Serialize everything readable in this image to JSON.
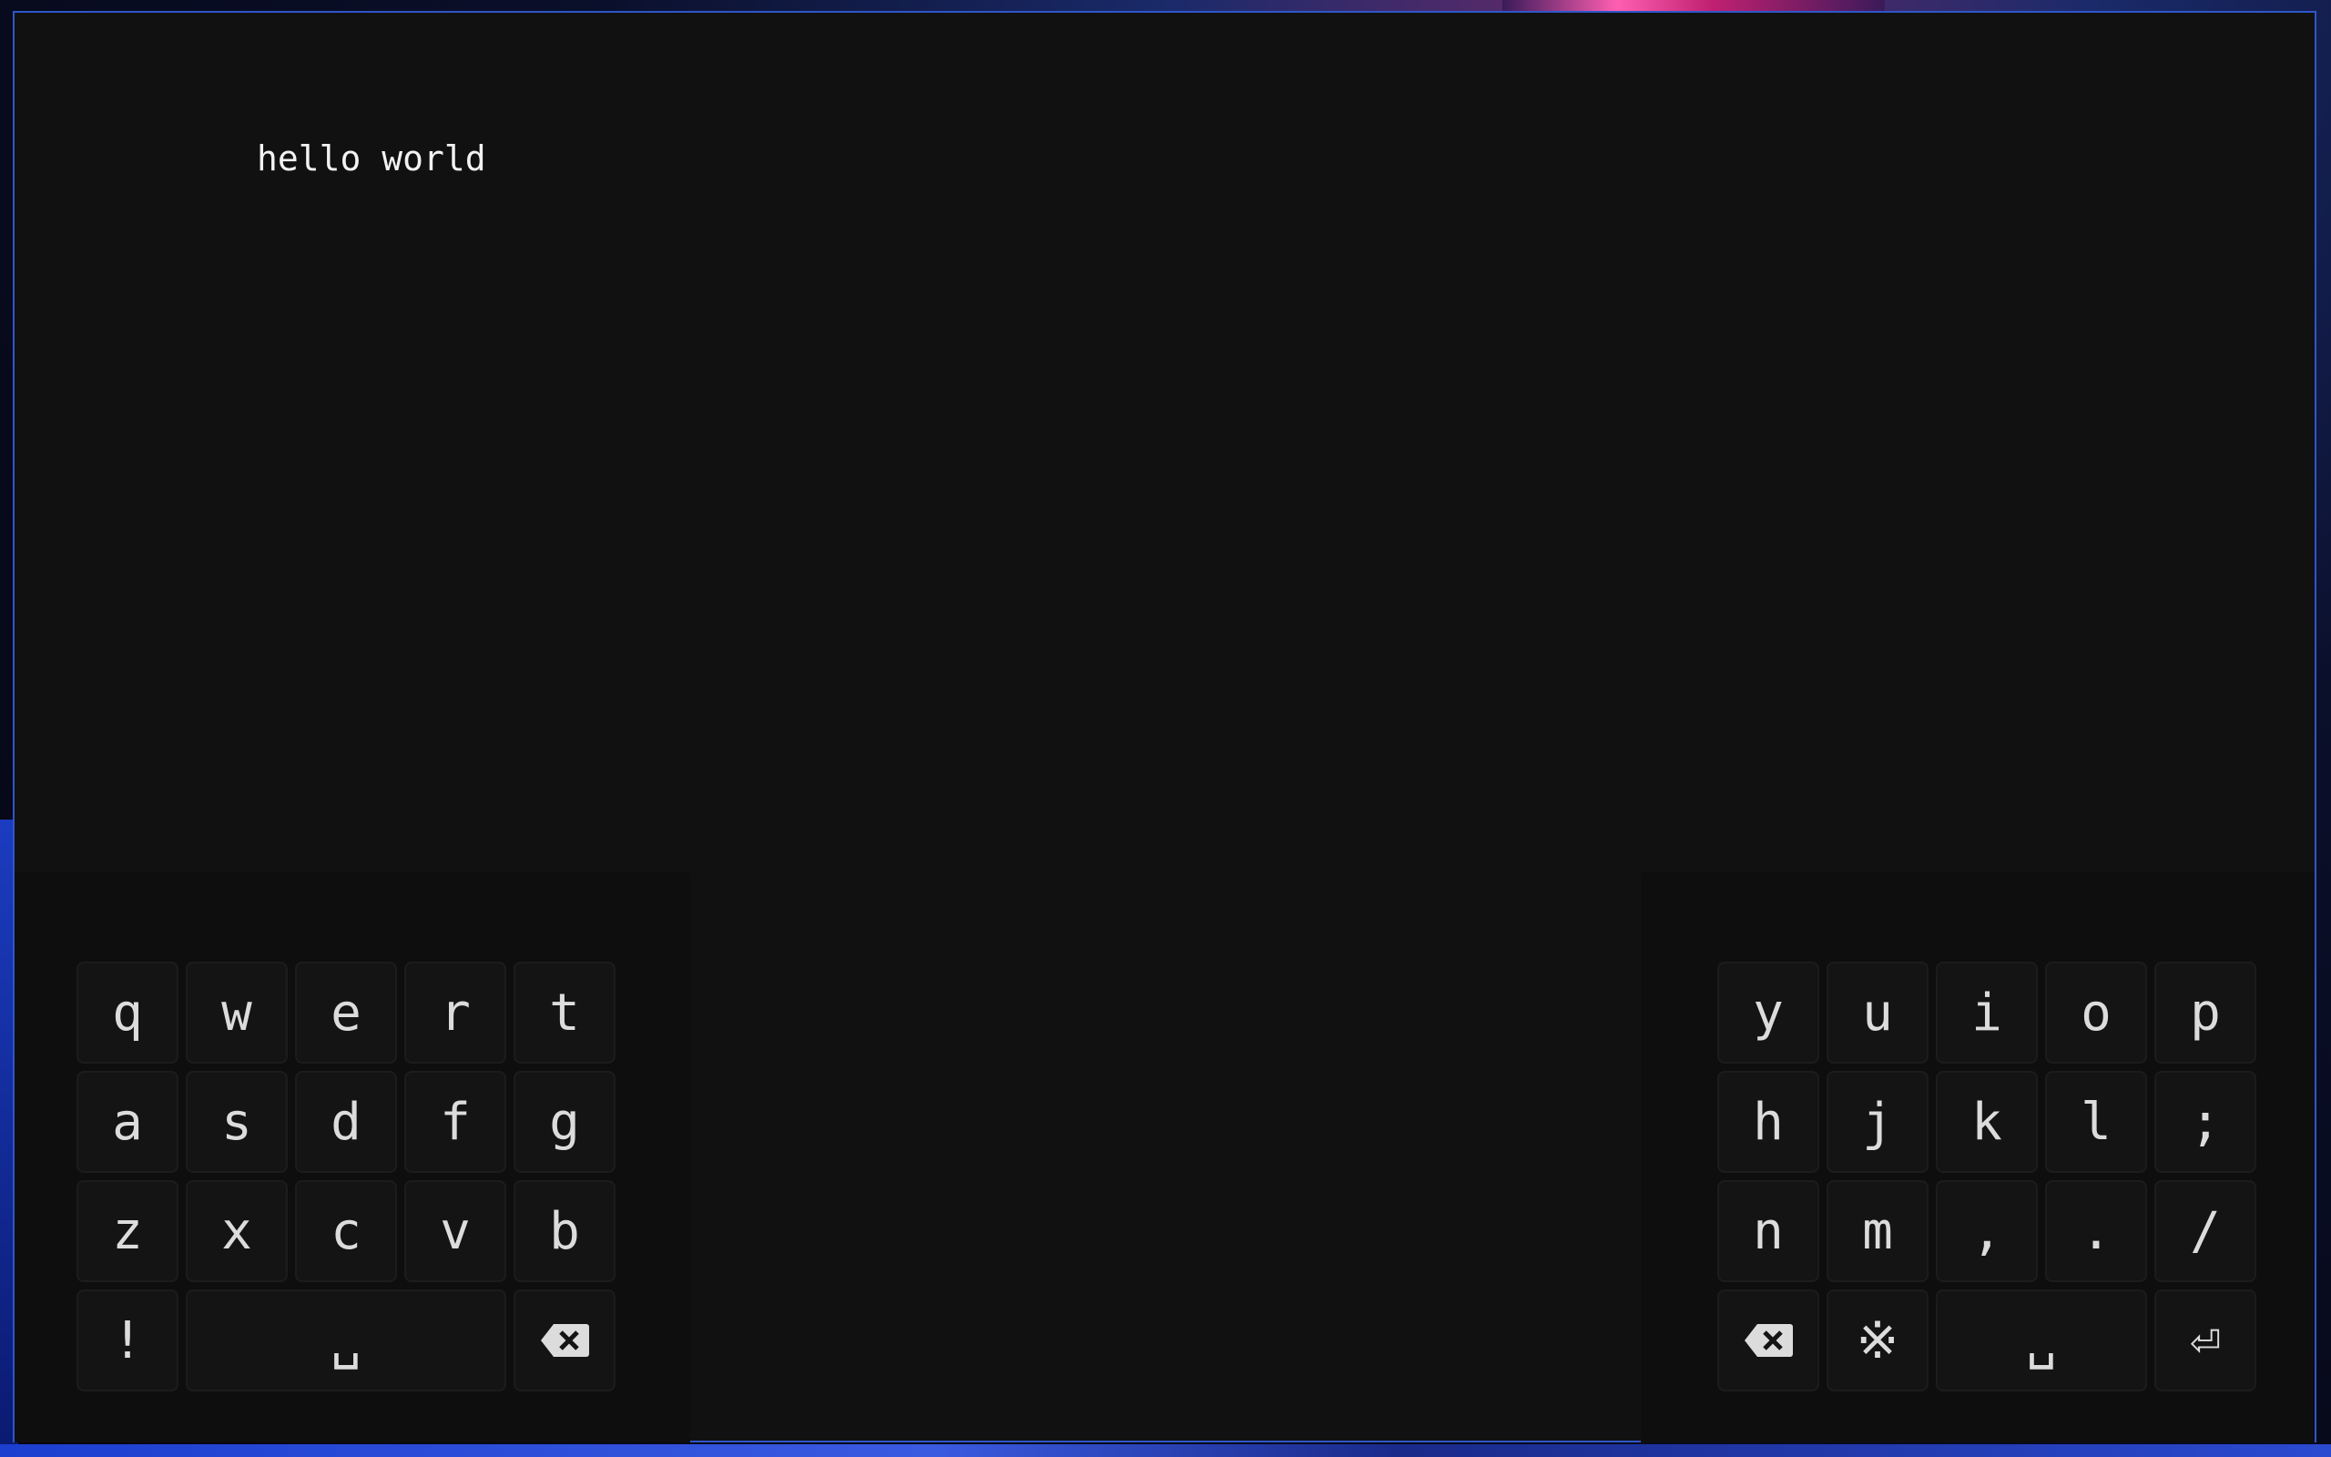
{
  "editor": {
    "text": "hello world"
  },
  "keyboard": {
    "left": {
      "row1": [
        "q",
        "w",
        "e",
        "r",
        "t"
      ],
      "row2": [
        "a",
        "s",
        "d",
        "f",
        "g"
      ],
      "row3": [
        "z",
        "x",
        "c",
        "v",
        "b"
      ],
      "row4": {
        "exclaim": "!",
        "space": "␣"
      }
    },
    "right": {
      "row1": [
        "y",
        "u",
        "i",
        "o",
        "p"
      ],
      "row2": [
        "h",
        "j",
        "k",
        "l",
        ";"
      ],
      "row3": [
        "n",
        "m",
        ",",
        ".",
        "/"
      ],
      "row4": {
        "symbol": "※",
        "space": "␣",
        "enter": "⏎"
      }
    }
  },
  "icons": {
    "backspace": "backspace-icon",
    "enter": "enter-icon"
  },
  "colors": {
    "window_border": "#2f56c9",
    "key_bg": "#141414",
    "window_bg": "#111111"
  }
}
